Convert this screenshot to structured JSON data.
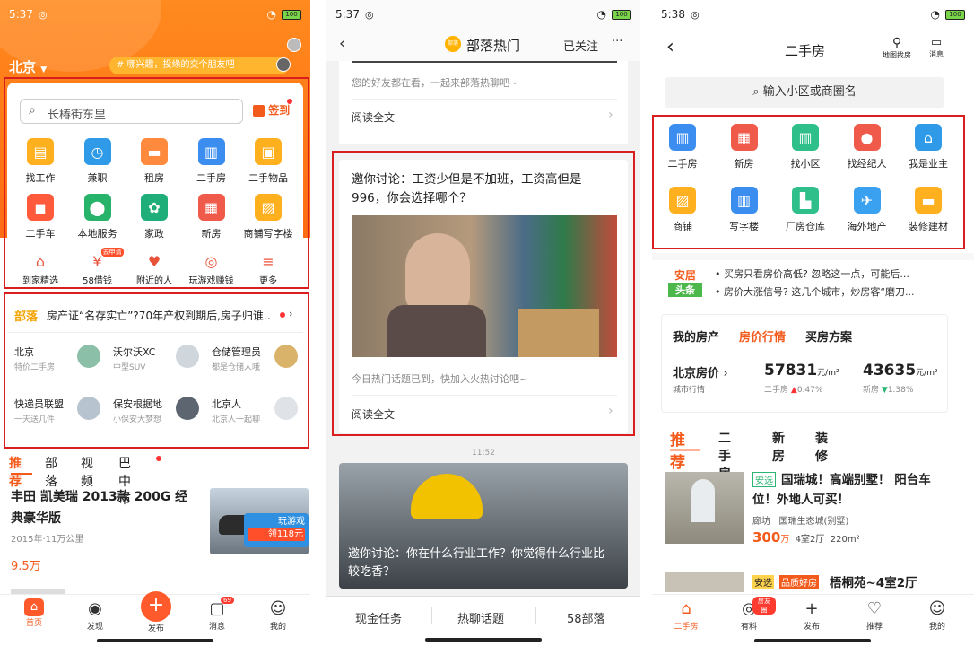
{
  "colors": {
    "brand_orange": "#f35b1c",
    "highlight_red": "#d81e1e"
  },
  "panel1": {
    "time": "5:37",
    "battery": "100",
    "city": "北京",
    "promo": "# 哪兴趣，投缘的交个朋友吧",
    "search_placeholder": "长椿街东里",
    "signin": "签到",
    "grid": [
      {
        "label": "找工作",
        "icon": "briefcase-icon"
      },
      {
        "label": "兼职",
        "icon": "clock-icon"
      },
      {
        "label": "租房",
        "icon": "sofa-icon"
      },
      {
        "label": "二手房",
        "icon": "building-icon"
      },
      {
        "label": "二手物品",
        "icon": "box-icon"
      },
      {
        "label": "二手车",
        "icon": "car-icon"
      },
      {
        "label": "本地服务",
        "icon": "map-pin-icon"
      },
      {
        "label": "家政",
        "icon": "plant-icon"
      },
      {
        "label": "新房",
        "icon": "new-house-icon"
      },
      {
        "label": "商铺写字楼",
        "icon": "shop-icon"
      }
    ],
    "row3": [
      {
        "label": "到家精选",
        "icon": "home-icon"
      },
      {
        "label": "58借钱",
        "icon": "wallet-icon",
        "badge": "去申请"
      },
      {
        "label": "附近的人",
        "icon": "heart-icon"
      },
      {
        "label": "玩游戏赚钱",
        "icon": "gamepad-icon"
      },
      {
        "label": "更多",
        "icon": "more-icon"
      }
    ],
    "tribe_tag": "部落",
    "tribe_headline": "房产证“名存实亡”?70年产权到期后,房子归谁...",
    "tribes": [
      {
        "name": "北京",
        "sub": "特价二手房"
      },
      {
        "name": "沃尔沃XC",
        "sub": "中型SUV"
      },
      {
        "name": "仓储管理员",
        "sub": "都是仓储人哦"
      },
      {
        "name": "快递员联盟",
        "sub": "一天送几件"
      },
      {
        "name": "保安根据地",
        "sub": "小保安大梦想"
      },
      {
        "name": "北京人",
        "sub": "北京人一起聊"
      }
    ],
    "feed_tabs": [
      "推荐",
      "部落",
      "视频",
      "巴中市"
    ],
    "post_title": "丰田 凯美瑞 2013款 200G 经典豪华版",
    "post_meta": "2015年·11万公里",
    "post_price": "9.5万",
    "game_label": "玩游戏",
    "game_reward": "领118元",
    "nav": [
      {
        "label": "首页",
        "icon": "home-icon"
      },
      {
        "label": "发现",
        "icon": "discover-icon"
      },
      {
        "label": "发布",
        "icon": "plus-icon"
      },
      {
        "label": "消息",
        "icon": "message-icon",
        "badge": "69"
      },
      {
        "label": "我的",
        "icon": "smile-icon"
      }
    ]
  },
  "panel2": {
    "time": "5:37",
    "battery": "100",
    "title": "部落热门",
    "logo_text": "部落",
    "follow": "已关注",
    "more": "···",
    "top_desc": "您的好友都在看，一起来部落热聊吧~",
    "read_more": "阅读全文",
    "card1_title": "邀你讨论：工资少但是不加班，工资高但是996，你会选择哪个？",
    "card1_desc": "今日热门话题已到，快加入火热讨论吧~",
    "card1_read": "阅读全文",
    "time_label": "11:52",
    "card2_title": "邀你讨论：你在什么行业工作？你觉得什么行业比较吃香？",
    "bottom_tabs": [
      "现金任务",
      "热聊话题",
      "58部落"
    ]
  },
  "panel3": {
    "time": "5:38",
    "battery": "100",
    "title": "二手房",
    "map_label": "地图找房",
    "msg_label": "消息",
    "search_placeholder": "输入小区或商圈名",
    "grid": [
      {
        "label": "二手房",
        "icon": "building-icon"
      },
      {
        "label": "新房",
        "icon": "new-house-icon"
      },
      {
        "label": "找小区",
        "icon": "community-icon"
      },
      {
        "label": "找经纪人",
        "icon": "agent-icon"
      },
      {
        "label": "我是业主",
        "icon": "owner-icon"
      },
      {
        "label": "商铺",
        "icon": "shop-icon"
      },
      {
        "label": "写字楼",
        "icon": "office-icon"
      },
      {
        "label": "厂房仓库",
        "icon": "factory-icon"
      },
      {
        "label": "海外地产",
        "icon": "plane-icon"
      },
      {
        "label": "装修建材",
        "icon": "paint-roller-icon"
      }
    ],
    "news_logo_top": "安居",
    "news_logo_bottom": "头条",
    "news": [
      "买房只看房价高低? 忽略这一点，可能后...",
      "房价大涨信号? 这几个城市，炒房客“磨刀..."
    ],
    "tabs": [
      "我的房产",
      "房价行情",
      "买房方案"
    ],
    "price_city": "北京房价",
    "price_sub": "城市行情",
    "price1": "57831",
    "price1_unit": "元/m²",
    "price1_label": "二手房",
    "price1_change": "0.47%",
    "price2": "43635",
    "price2_unit": "元/m²",
    "price2_label": "新房",
    "price2_change": "1.38%",
    "feed_tabs": [
      "推荐",
      "二手房",
      "新房",
      "装修"
    ],
    "listing_tag": "安选",
    "listing_title": "国瑞城！高端别墅！  阳台车位！外地人可买！",
    "listing_loc": "廊坊",
    "listing_estate": "国瑞生态城(别墅)",
    "listing_price": "300",
    "listing_price_unit": "万",
    "listing_rooms": "4室2厅",
    "listing_area": "220m²",
    "listing2_tag1": "安选",
    "listing2_tag2": "品质好房",
    "listing2_title": "梧桐苑~4室2厅",
    "nav": [
      {
        "label": "二手房",
        "icon": "house-icon"
      },
      {
        "label": "有料",
        "icon": "disc-icon",
        "badge": "房友圈"
      },
      {
        "label": "发布",
        "icon": "plus-icon"
      },
      {
        "label": "推荐",
        "icon": "heart-icon"
      },
      {
        "label": "我的",
        "icon": "user-icon"
      }
    ]
  }
}
